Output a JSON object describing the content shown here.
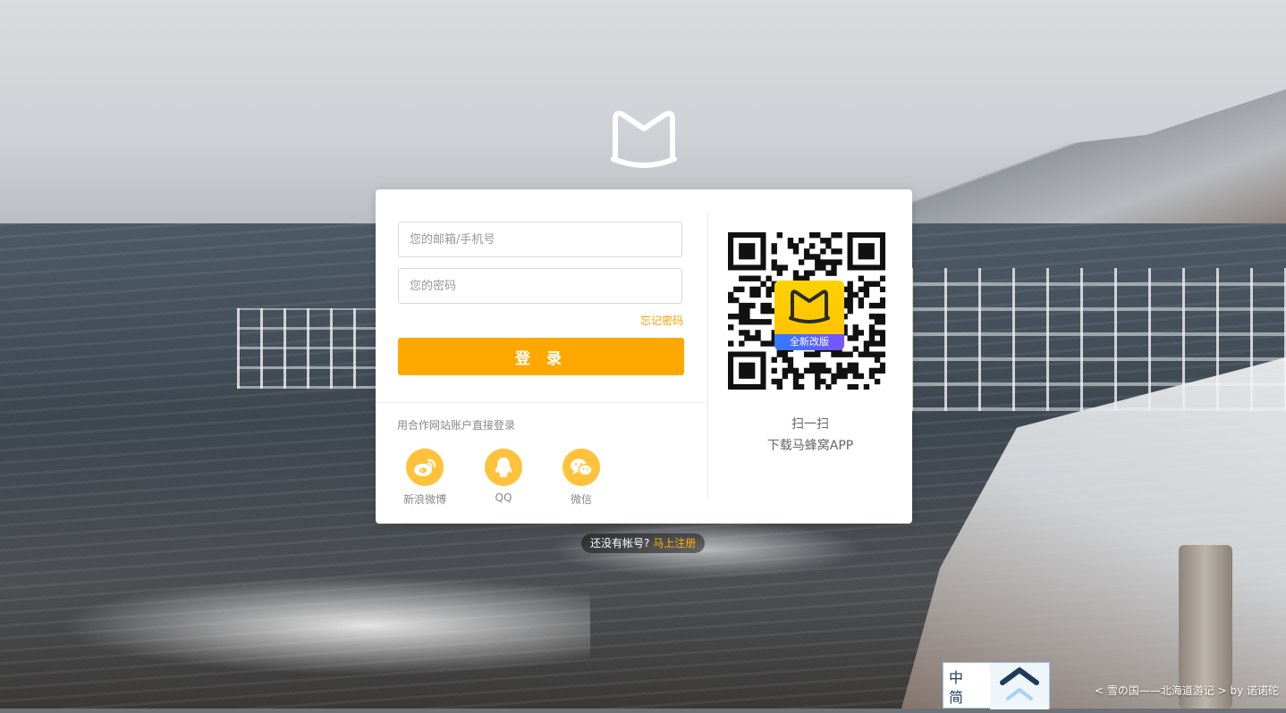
{
  "login": {
    "email_placeholder": "您的邮箱/手机号",
    "password_placeholder": "您的密码",
    "forgot_label": "忘记密码",
    "submit_label": "登 录"
  },
  "partner": {
    "title": "用合作网站账户直接登录",
    "items": [
      {
        "label": "新浪微博",
        "icon": "weibo-icon"
      },
      {
        "label": "QQ",
        "icon": "qq-icon"
      },
      {
        "label": "微信",
        "icon": "wechat-icon"
      }
    ]
  },
  "app": {
    "badge_label": "全新改版",
    "scan_line1": "扫一扫",
    "scan_line2": "下载马蜂窝APP"
  },
  "register": {
    "prompt": "还没有帐号?",
    "link": "马上注册"
  },
  "caption": "< 雪の国——北海道游记 > by 诺诺砣",
  "language": {
    "line1": "中",
    "line2": "简"
  },
  "colors": {
    "accent": "#ffa800",
    "social": "#ffc23a",
    "link": "#ff9d00"
  }
}
